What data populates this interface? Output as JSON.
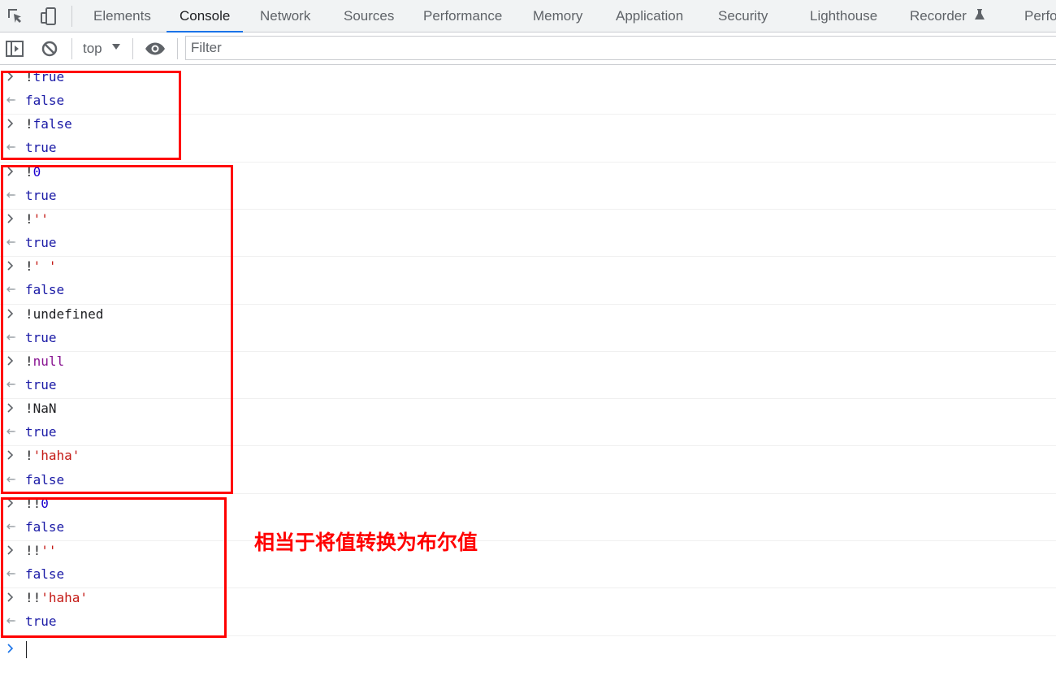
{
  "tabs": {
    "items": [
      "Elements",
      "Console",
      "Network",
      "Sources",
      "Performance",
      "Memory",
      "Application",
      "Security",
      "Lighthouse",
      "Recorder",
      "Perfo"
    ],
    "active": "Console"
  },
  "toolbar": {
    "context": "top",
    "filter_placeholder": "Filter",
    "filter_value": ""
  },
  "console": {
    "entries": [
      {
        "kind": "input",
        "prefix": "!",
        "value": "true",
        "value_type": "bool"
      },
      {
        "kind": "output",
        "value": "false",
        "value_type": "bool"
      },
      {
        "kind": "input",
        "prefix": "!",
        "value": "false",
        "value_type": "bool"
      },
      {
        "kind": "output",
        "value": "true",
        "value_type": "bool"
      },
      {
        "kind": "input",
        "prefix": "!",
        "value": "0",
        "value_type": "num"
      },
      {
        "kind": "output",
        "value": "true",
        "value_type": "bool"
      },
      {
        "kind": "input",
        "prefix": "!",
        "value": "''",
        "value_type": "str"
      },
      {
        "kind": "output",
        "value": "true",
        "value_type": "bool"
      },
      {
        "kind": "input",
        "prefix": "!",
        "value": "' '",
        "value_type": "str"
      },
      {
        "kind": "output",
        "value": "false",
        "value_type": "bool"
      },
      {
        "kind": "input",
        "prefix": "!",
        "value": "undefined",
        "value_type": "default"
      },
      {
        "kind": "output",
        "value": "true",
        "value_type": "bool"
      },
      {
        "kind": "input",
        "prefix": "!",
        "value": "null",
        "value_type": "null"
      },
      {
        "kind": "output",
        "value": "true",
        "value_type": "bool"
      },
      {
        "kind": "input",
        "prefix": "!",
        "value": "NaN",
        "value_type": "default"
      },
      {
        "kind": "output",
        "value": "true",
        "value_type": "bool"
      },
      {
        "kind": "input",
        "prefix": "!",
        "value": "'haha'",
        "value_type": "str"
      },
      {
        "kind": "output",
        "value": "false",
        "value_type": "bool"
      },
      {
        "kind": "input",
        "prefix": "!!",
        "value": "0",
        "value_type": "num"
      },
      {
        "kind": "output",
        "value": "false",
        "value_type": "bool"
      },
      {
        "kind": "input",
        "prefix": "!!",
        "value": "''",
        "value_type": "str"
      },
      {
        "kind": "output",
        "value": "false",
        "value_type": "bool"
      },
      {
        "kind": "input",
        "prefix": "!!",
        "value": "'haha'",
        "value_type": "str"
      },
      {
        "kind": "output",
        "value": "true",
        "value_type": "bool"
      }
    ]
  },
  "annotation": {
    "note": "相当于将值转换为布尔值",
    "color": "#ff0000"
  },
  "icons": {
    "inspect": "inspect-element-icon",
    "device": "device-toolbar-icon",
    "sidebar": "show-sidebar-icon",
    "clear": "clear-console-icon",
    "eye": "live-expression-icon",
    "recorder_badge": "experiment-flask-icon",
    "input_prompt": "chevron-right-icon",
    "output_result": "return-arrow-icon"
  },
  "colors": {
    "accent": "#1a73e8",
    "boolean": "#1a1aa6",
    "number": "#1c00cf",
    "string": "#c41a16",
    "null": "#881391"
  }
}
